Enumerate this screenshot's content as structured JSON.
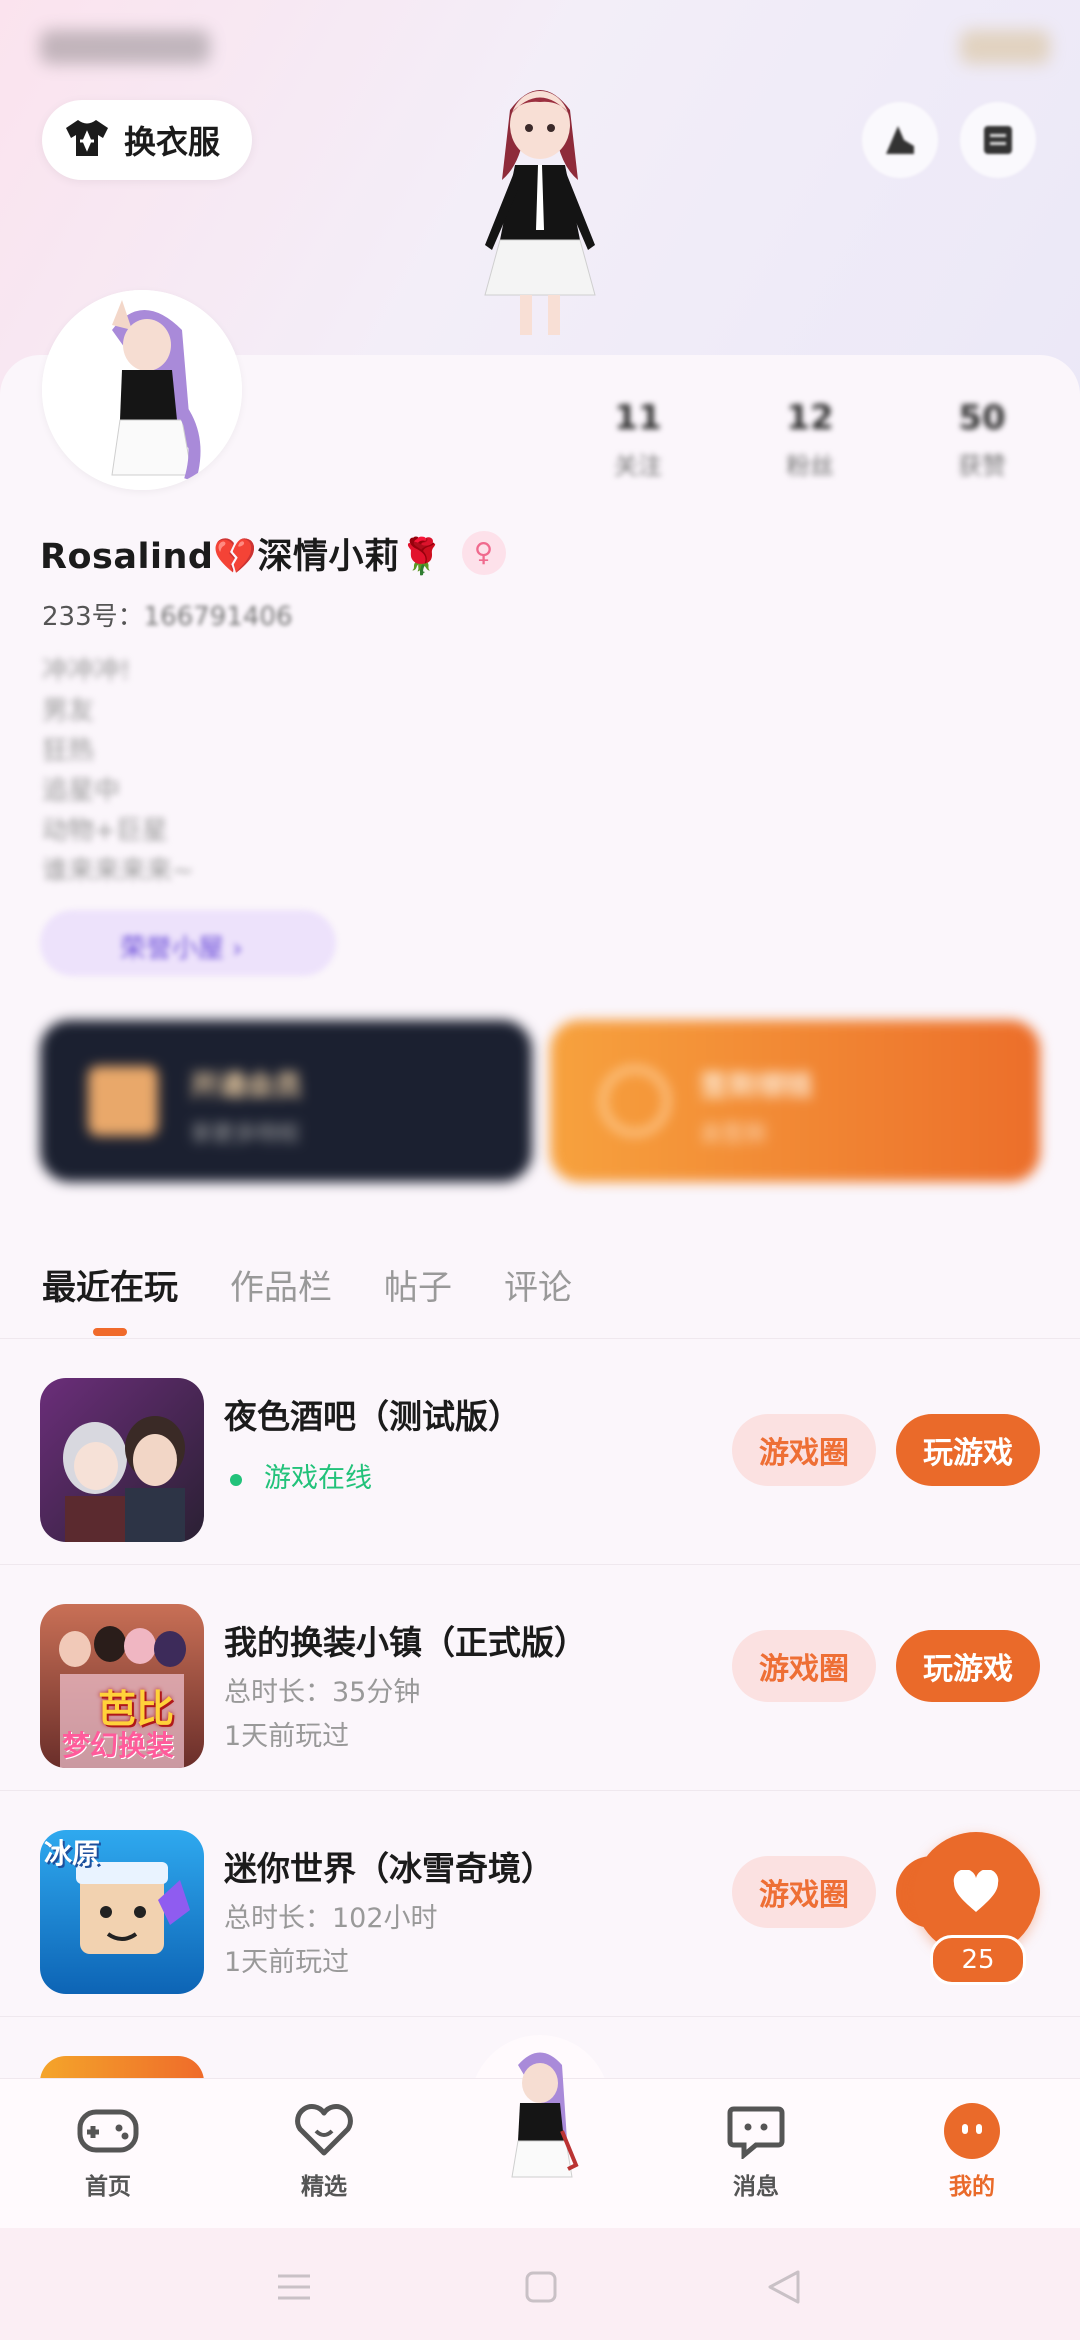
{
  "header": {
    "dress_button_label": "换衣服",
    "icon_left": "share-icon",
    "icon_right": "menu-icon"
  },
  "profile": {
    "stats": [
      {
        "value": "11",
        "label": "关注"
      },
      {
        "value": "12",
        "label": "粉丝"
      },
      {
        "value": "50",
        "label": "获赞"
      }
    ],
    "name": "Rosalind💔深情小莉🌹",
    "gender": "female",
    "id_prefix": "233号：",
    "id_number": "166791406",
    "bio_lines": [
      "冲冲冲!",
      "男友",
      "狂热",
      "追星中",
      "动物+巨星",
      "谁来来来来~"
    ],
    "badge_label": "荣誉小屋 ›"
  },
  "promos": {
    "dark": {
      "title": "开通会员",
      "subtitle": "享更多特权"
    },
    "orange": {
      "title": "签到领钱",
      "subtitle": "去签到"
    }
  },
  "tabs": [
    {
      "label": "最近在玩",
      "active": true
    },
    {
      "label": "作品栏",
      "active": false
    },
    {
      "label": "帖子",
      "active": false
    },
    {
      "label": "评论",
      "active": false
    }
  ],
  "games": [
    {
      "title": "夜色酒吧（测试版）",
      "status": "游戏在线",
      "online": true,
      "circle_label": "游戏圈",
      "play_label": "玩游戏"
    },
    {
      "title": "我的换装小镇（正式版）",
      "duration": "总时长：35分钟",
      "last_played": "1天前玩过",
      "circle_label": "游戏圈",
      "play_label": "玩游戏",
      "icon_text": [
        "芭比",
        "梦幻换装"
      ]
    },
    {
      "title": "迷你世界（冰雪奇境）",
      "duration": "总时长：102小时",
      "last_played": "1天前玩过",
      "circle_label": "游戏圈",
      "play_label": "玩游戏",
      "icon_text": [
        "冰原"
      ]
    }
  ],
  "fab": {
    "count": "25",
    "icon": "heart-icon"
  },
  "bottom_nav": [
    {
      "label": "首页",
      "icon": "gamepad-icon"
    },
    {
      "label": "精选",
      "icon": "heart-chat-icon"
    },
    {
      "label": "",
      "icon": "avatar-center"
    },
    {
      "label": "消息",
      "icon": "message-icon"
    },
    {
      "label": "我的",
      "icon": "profile-face-icon",
      "active": true
    }
  ],
  "colors": {
    "accent": "#ea6a2a",
    "online": "#22c27a",
    "circle_bg": "#fbe1e1"
  }
}
